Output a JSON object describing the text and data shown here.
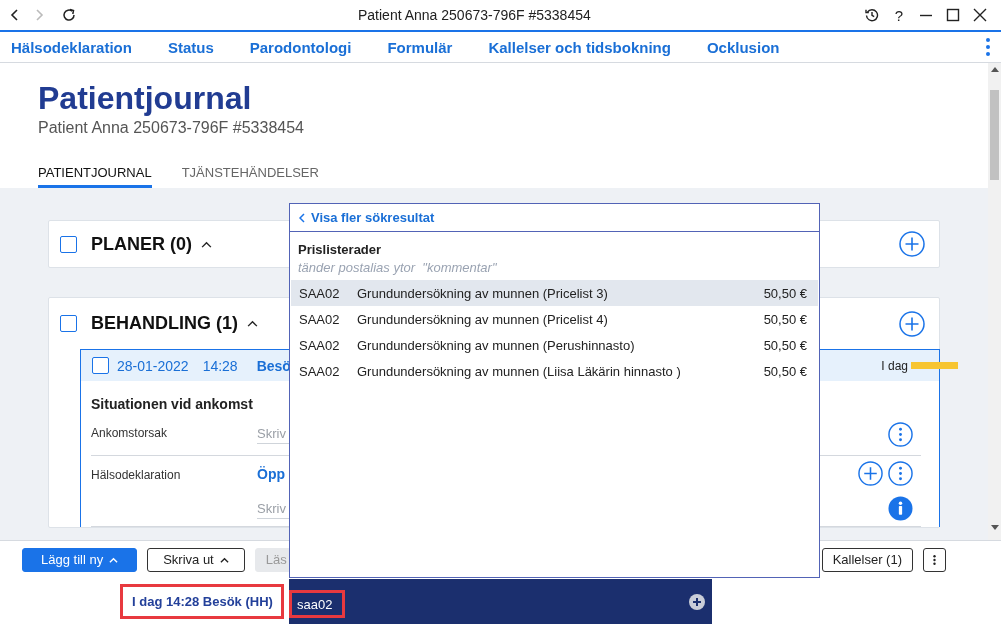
{
  "window": {
    "title": "Patient Anna 250673-796F #5338454",
    "help": "?"
  },
  "nav": {
    "items": [
      "Hälsodeklaration",
      "Status",
      "Parodontologi",
      "Formulär",
      "Kallelser och tidsbokning",
      "Ocklusion"
    ]
  },
  "header": {
    "title": "Patientjournal",
    "subtitle": "Patient Anna 250673-796F #5338454"
  },
  "tabs": [
    {
      "label": "PATIENTJOURNAL",
      "selected": true
    },
    {
      "label": "TJÄNSTEHÄNDELSER",
      "selected": false
    }
  ],
  "sections": [
    {
      "title": "PLANER (0)",
      "checked": false,
      "expanded": true
    },
    {
      "title": "BEHANDLING (1)",
      "checked": false,
      "expanded": true,
      "entries": [
        {
          "date": "28-01-2022",
          "time": "14:28",
          "title": "Besö",
          "checked": false,
          "when": "I dag",
          "color": "#f7c531",
          "heading": "Situationen vid ankomst",
          "fields": [
            {
              "kind": "input",
              "label": "Ankomstorsak",
              "placeholder": "Skriv"
            },
            {
              "kind": "link",
              "label": "Hälsodeklaration",
              "link": "Öpp",
              "placeholder": "Skriv"
            }
          ]
        }
      ]
    }
  ],
  "toolbar": {
    "left": [
      {
        "kind": "primary",
        "label": "Lägg till ny",
        "disabled": false
      },
      {
        "kind": "menu",
        "label": "Skriva ut",
        "disabled": false
      },
      {
        "kind": "plain",
        "label": "Läs",
        "disabled": true
      }
    ],
    "right": [
      {
        "kind": "plain",
        "label": "Kallelser (1)",
        "disabled": false
      },
      {
        "kind": "more",
        "disabled": false
      }
    ]
  },
  "footer": {
    "status": {
      "text": "I dag 14:28 Besök (HH)",
      "highlighted": true
    }
  },
  "search_popup": {
    "back_link": "Visa fler sökresultat",
    "group_title": "Prislisterader",
    "group_hint": "tänder postalias ytor  \"kommentar\"",
    "results": [
      {
        "code": "SAA02",
        "description": "Grundundersökning av munnen (Pricelist 3)",
        "price": "50,50 €",
        "selected": true
      },
      {
        "code": "SAA02",
        "description": "Grundundersökning av munnen (Pricelist 4)",
        "price": "50,50 €",
        "selected": false
      },
      {
        "code": "SAA02",
        "description": "Grundundersökning av munnen (Perushinnasto)",
        "price": "50,50 €",
        "selected": false
      },
      {
        "code": "SAA02",
        "description": "Grundundersökning av munnen (Liisa Läkärin hinnasto )",
        "price": "50,50 €",
        "selected": false
      }
    ],
    "search": {
      "value": "saa02",
      "highlighted": true
    }
  }
}
